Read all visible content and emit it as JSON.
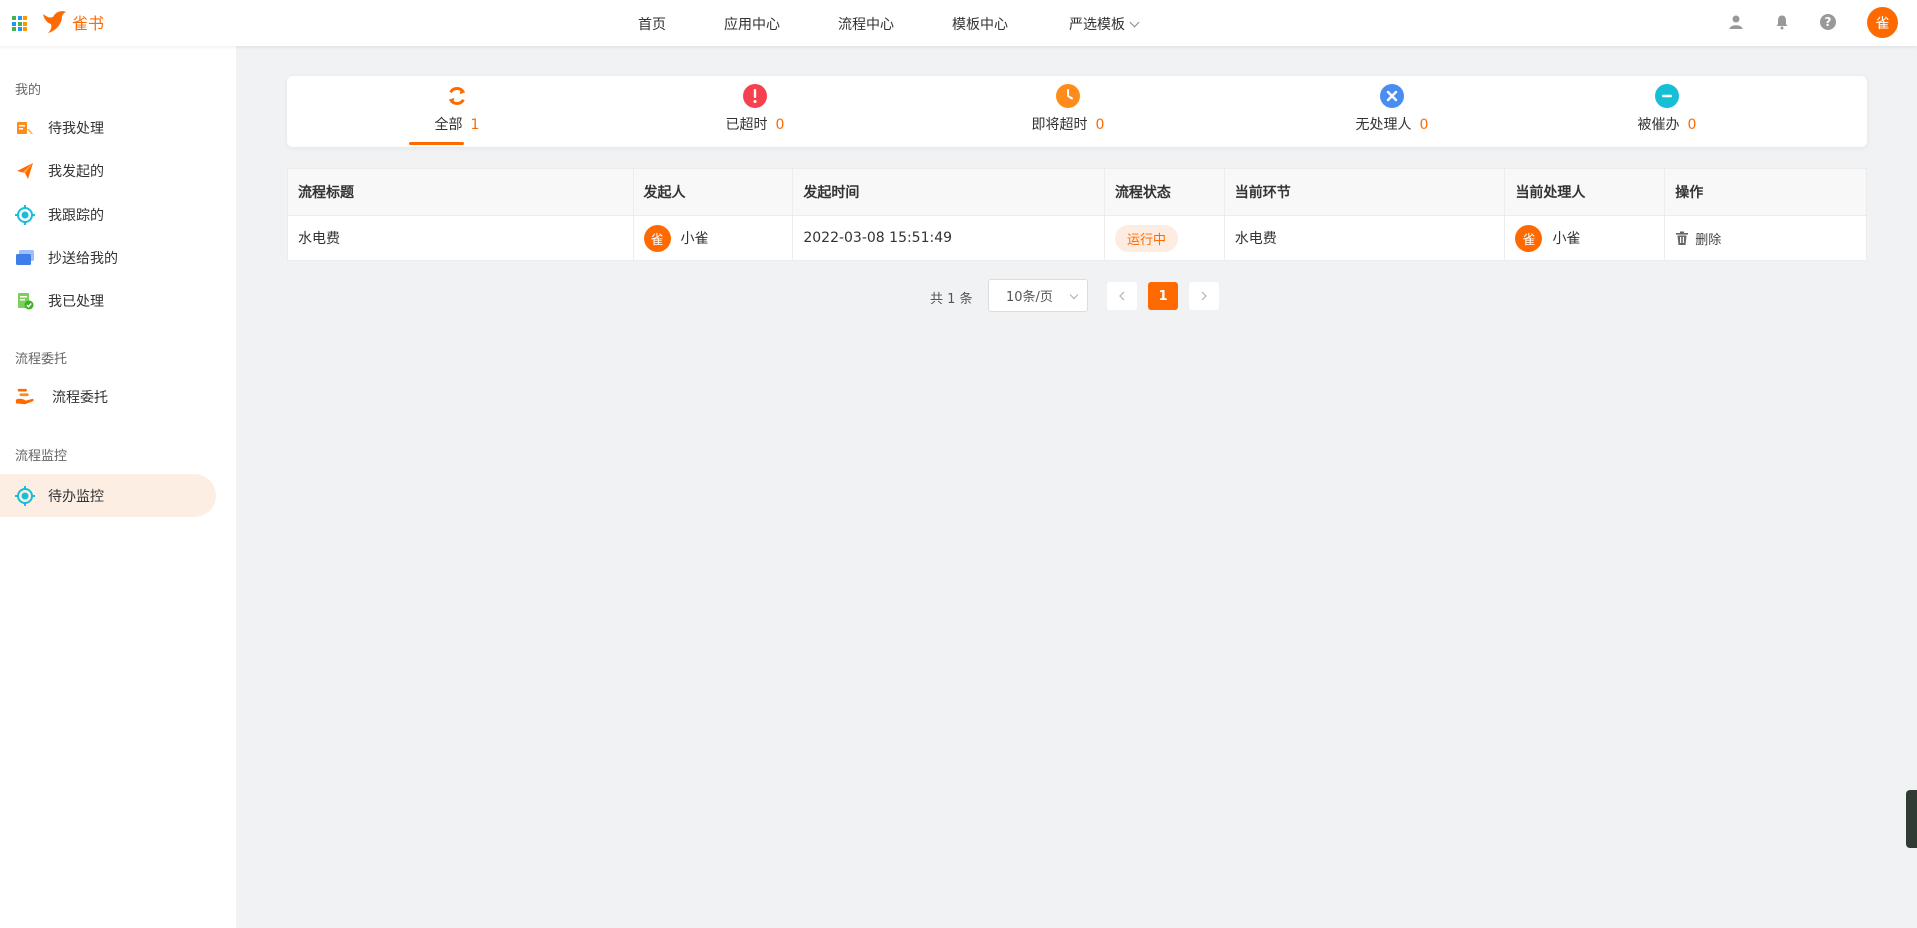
{
  "app": {
    "name": "雀书",
    "avatar_text": "雀"
  },
  "nav": [
    {
      "label": "首页"
    },
    {
      "label": "应用中心"
    },
    {
      "label": "流程中心"
    },
    {
      "label": "模板中心"
    },
    {
      "label": "严选模板"
    }
  ],
  "top_icons": [
    "user-icon",
    "bell-icon",
    "help-icon"
  ],
  "sidebar": {
    "sections": [
      {
        "title": "我的",
        "items": [
          {
            "label": "待我处理",
            "icon": "todo-icon"
          },
          {
            "label": "我发起的",
            "icon": "send-icon"
          },
          {
            "label": "我跟踪的",
            "icon": "target-icon"
          },
          {
            "label": "抄送给我的",
            "icon": "cc-icon"
          },
          {
            "label": "我已处理",
            "icon": "done-icon"
          }
        ]
      },
      {
        "title": "流程委托",
        "items": [
          {
            "label": "流程委托",
            "icon": "delegate-icon"
          }
        ]
      },
      {
        "title": "流程监控",
        "items": [
          {
            "label": "待办监控",
            "icon": "monitor-icon",
            "active": true
          }
        ]
      }
    ]
  },
  "tabs": [
    {
      "label": "全部",
      "count": "1",
      "icon": "refresh-icon",
      "color": "#ff6a00",
      "active": true
    },
    {
      "label": "已超时",
      "count": "0",
      "icon": "exclamation-icon",
      "color": "#f5424e"
    },
    {
      "label": "即将超时",
      "count": "0",
      "icon": "clock-icon",
      "color": "#ff8c1a"
    },
    {
      "label": "无处理人",
      "count": "0",
      "icon": "close-icon",
      "color": "#4a8df0"
    },
    {
      "label": "被催办",
      "count": "0",
      "icon": "minus-icon",
      "color": "#16bfd6"
    }
  ],
  "table": {
    "headers": [
      "流程标题",
      "发起人",
      "发起时间",
      "流程状态",
      "当前环节",
      "当前处理人",
      "操作"
    ],
    "rows": [
      {
        "title": "水电费",
        "initiator_avatar": "雀",
        "initiator": "小雀",
        "start_time": "2022-03-08 15:51:49",
        "status": "运行中",
        "current_step": "水电费",
        "handler_avatar": "雀",
        "handler": "小雀",
        "action": "删除"
      }
    ]
  },
  "pagination": {
    "total_text": "共 1 条",
    "page_size": "10条/页",
    "current_page": "1"
  },
  "colors": {
    "accent": "#ff6a00",
    "background": "#f1f2f4"
  }
}
